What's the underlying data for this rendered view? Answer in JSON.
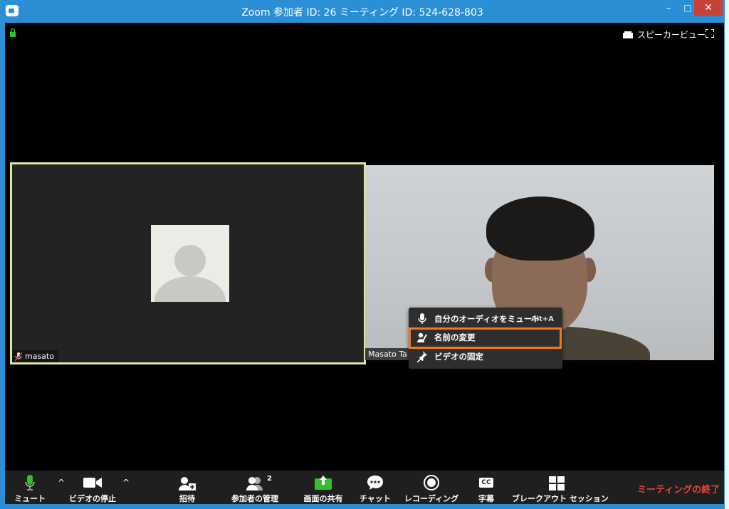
{
  "window": {
    "title": "Zoom 参加者 ID: 26 ミーティング ID: 524-628-803",
    "minimize": "–",
    "maximize": "□",
    "close": "✕"
  },
  "top_bar": {
    "speaker_view_label": "スピーカービュー"
  },
  "video_tiles": {
    "left": {
      "name": "masato"
    },
    "right": {
      "name": "Masato Ta"
    }
  },
  "context_menu": {
    "items": [
      {
        "label": "自分のオーディオをミュート",
        "shortcut": "Alt+A",
        "icon": "microphone-icon"
      },
      {
        "label": "名前の変更",
        "shortcut": "",
        "icon": "rename-icon"
      },
      {
        "label": "ビデオの固定",
        "shortcut": "",
        "icon": "pin-icon"
      }
    ],
    "highlighted_index": 1
  },
  "toolbar": {
    "mute": "ミュート",
    "stop_video": "ビデオの停止",
    "invite": "招待",
    "participants": "参加者の管理",
    "participants_count": "2",
    "share_screen": "画面の共有",
    "chat": "チャット",
    "recording": "レコーディング",
    "captions": "字幕",
    "captions_icon_text": "CC",
    "breakout": "ブレークアウト セッション",
    "end_meeting": "ミーティングの終了"
  },
  "colors": {
    "title_bar": "#2b8fd6",
    "active_speaker_border": "#dbe9a0",
    "highlight_box": "#f07a1e",
    "end_meeting": "#e9453f",
    "share_green": "#2ec12e",
    "mic_green": "#2ec12e"
  }
}
